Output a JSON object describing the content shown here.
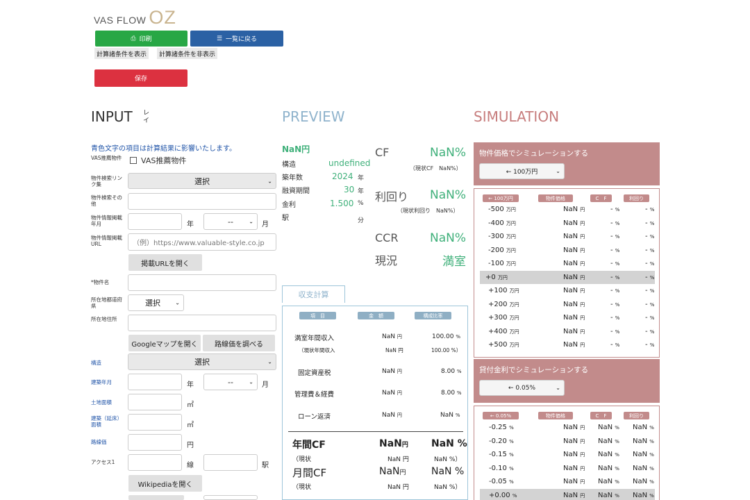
{
  "header": {
    "brand": "VAS FLOW",
    "logo": "OZ"
  },
  "toolbar": {
    "print": "印刷",
    "list": "一覧に戻る",
    "show_cond": "計算諸条件を表示",
    "hide_cond": "計算諸条件を非表示",
    "save": "保存"
  },
  "input": {
    "title": "INPUT",
    "layout": "レイアウト変更",
    "note": "青色文字の項目は計算結果に影響いたします。",
    "vas_label": "VAS推薦物件",
    "vas_check": "VAS推薦物件",
    "search_link_label": "物件検索リンク集",
    "search_link_value": "選択",
    "search_other_label": "物件検索その他",
    "info_date_label": "物件情報掲載年月",
    "year_unit": "年",
    "month_unit": "月",
    "month_value": "--",
    "info_url_label": "物件情報掲載URL",
    "url_placeholder": "（例）https://www.valuable-style.co.jp",
    "open_url": "掲載URLを開く",
    "name_label": "*物件名",
    "pref_label": "所在地都道府県",
    "pref_value": "選択",
    "addr_label": "所在地住所",
    "gmap": "Googleマップを開く",
    "route_price": "路線価を調べる",
    "struct_label": "構造",
    "struct_value": "選択",
    "built_label": "建築年月",
    "built_month": "--",
    "land_label": "土地面積",
    "area_unit": "㎡",
    "floor_label": "建築（延床）面積",
    "route_label": "路線価",
    "yen_unit": "円",
    "access_label": "アクセス1",
    "line_unit": "線",
    "station_unit": "駅",
    "wiki": "Wikipediaを開く"
  },
  "preview": {
    "title": "PREVIEW",
    "price": "NaN円",
    "struct_label": "構造",
    "struct_value": "undefined",
    "age_label": "築年数",
    "age_value": "2024",
    "age_unit": "年",
    "loan_label": "融資期間",
    "loan_value": "30",
    "loan_unit": "年",
    "rate_label": "金利",
    "rate_value": "1.500",
    "rate_unit": "%",
    "station_label": "駅",
    "station_unit": "分",
    "cf_label": "CF",
    "cf_value": "NaN%",
    "cf_sub": "（現状CF　NaN%）",
    "yield_label": "利回り",
    "yield_value": "NaN%",
    "yield_sub": "（現状利回り　NaN%）",
    "ccr_label": "CCR",
    "ccr_value": "NaN%",
    "status_label": "現況",
    "status_value": "満室",
    "calc_tab": "収支計算",
    "cols": [
      "項　目",
      "金　額",
      "構成比率"
    ],
    "rows": [
      {
        "label": "満室年間収入",
        "amount": "NaN",
        "unit": "円",
        "ratio": "100.00",
        "pct": "%"
      },
      {
        "label": "固定資産税",
        "amount": "NaN",
        "unit": "円",
        "ratio": "8.00",
        "pct": "%"
      },
      {
        "label": "管理費＆経費",
        "amount": "NaN",
        "unit": "円",
        "ratio": "8.00",
        "pct": "%"
      },
      {
        "label": "ローン返済",
        "amount": "NaN",
        "unit": "円",
        "ratio": "NaN",
        "pct": "%"
      }
    ],
    "sub_income": {
      "label": "（現状年間収入",
      "amount": "NaN 円",
      "ratio": "100.00 %）"
    },
    "annual_cf": {
      "label": "年間CF",
      "amount": "NaN",
      "unit": "円",
      "ratio": "NaN %"
    },
    "annual_sub": {
      "label": "（現状",
      "amount": "NaN 円",
      "ratio": "NaN %）"
    },
    "monthly_cf": {
      "label": "月間CF",
      "amount": "NaN",
      "unit": "円",
      "ratio": "NaN %"
    },
    "monthly_sub": {
      "label": "（現状",
      "amount": "NaN 円",
      "ratio": "NaN %）"
    }
  },
  "simulation": {
    "title": "SIMULATION",
    "price_panel": "物件価格でシミュレーションする",
    "price_step": "← 100万円",
    "price_cols": [
      "← 100万円",
      "物件価格",
      "C　F",
      "利回り"
    ],
    "price_rows": [
      {
        "d": "-500",
        "u": "万円",
        "p": "NaN",
        "cf": "-",
        "y": "-",
        "hl": false
      },
      {
        "d": "-400",
        "u": "万円",
        "p": "NaN",
        "cf": "-",
        "y": "-",
        "hl": false
      },
      {
        "d": "-300",
        "u": "万円",
        "p": "NaN",
        "cf": "-",
        "y": "-",
        "hl": false
      },
      {
        "d": "-200",
        "u": "万円",
        "p": "NaN",
        "cf": "-",
        "y": "-",
        "hl": false
      },
      {
        "d": "-100",
        "u": "万円",
        "p": "NaN",
        "cf": "-",
        "y": "-",
        "hl": false
      },
      {
        "d": "+0",
        "u": "万円",
        "p": "NaN",
        "cf": "-",
        "y": "-",
        "hl": true
      },
      {
        "d": "+100",
        "u": "万円",
        "p": "NaN",
        "cf": "-",
        "y": "-",
        "hl": false
      },
      {
        "d": "+200",
        "u": "万円",
        "p": "NaN",
        "cf": "-",
        "y": "-",
        "hl": false
      },
      {
        "d": "+300",
        "u": "万円",
        "p": "NaN",
        "cf": "-",
        "y": "-",
        "hl": false
      },
      {
        "d": "+400",
        "u": "万円",
        "p": "NaN",
        "cf": "-",
        "y": "-",
        "hl": false
      },
      {
        "d": "+500",
        "u": "万円",
        "p": "NaN",
        "cf": "-",
        "y": "-",
        "hl": false
      }
    ],
    "rate_panel": "貸付金利でシミュレーションする",
    "rate_step": "← 0.05%",
    "rate_cols": [
      "← 0.05%",
      "物件価格",
      "C　F",
      "利回り"
    ],
    "rate_rows": [
      {
        "d": "-0.25",
        "u": "%",
        "p": "NaN",
        "cf": "NaN",
        "y": "NaN",
        "hl": false
      },
      {
        "d": "-0.20",
        "u": "%",
        "p": "NaN",
        "cf": "NaN",
        "y": "NaN",
        "hl": false
      },
      {
        "d": "-0.15",
        "u": "%",
        "p": "NaN",
        "cf": "NaN",
        "y": "NaN",
        "hl": false
      },
      {
        "d": "-0.10",
        "u": "%",
        "p": "NaN",
        "cf": "NaN",
        "y": "NaN",
        "hl": false
      },
      {
        "d": "-0.05",
        "u": "%",
        "p": "NaN",
        "cf": "NaN",
        "y": "NaN",
        "hl": false
      },
      {
        "d": "+0.00",
        "u": "%",
        "p": "NaN",
        "cf": "NaN",
        "y": "NaN",
        "hl": true
      }
    ],
    "yen": "円",
    "pct": "%"
  }
}
